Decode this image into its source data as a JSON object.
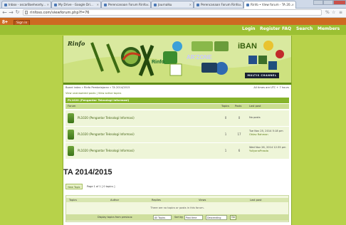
{
  "browser": {
    "tabs": [
      {
        "label": "Inbox - oscarBoehearty..."
      },
      {
        "label": "My Drive - Google Dri..."
      },
      {
        "label": "Perencanaan Forum Rinfo..."
      },
      {
        "label": "Journalku"
      },
      {
        "label": "Perencanaan Forum Rinfo..."
      },
      {
        "label": "Rinfo • View forum - TA 20..."
      }
    ],
    "url": "rinfoso.com/viewforum.php?f=76"
  },
  "google_bar": {
    "gplus": "8+",
    "signin": "Sign in"
  },
  "site_menu": [
    "Login",
    "Register",
    "FAQ",
    "Search",
    "Members"
  ],
  "banner": {
    "logo": "Rinfo",
    "rinfo": "Rinfo",
    "ar": "AR'ZONE",
    "iban": "iBAN",
    "mul": "MULTIS CHANNEL"
  },
  "breadcrumb": "Board index » Rinfo Pembelajaran » TA 2014/2015",
  "server_time": "All times are UTC + 7 hours",
  "view_links": "View unanswered posts | View active topics",
  "category_title": "PL1020 (Pengantar Teknologi Informasi)",
  "table_headers": {
    "forum": "Forum",
    "topics": "Topics",
    "posts": "Posts",
    "last": "Last post"
  },
  "forums": [
    {
      "name": "PL1020 (Pengantar Teknologi Informasi)",
      "topics": "0",
      "posts": "0",
      "last1": "No posts",
      "last2": ""
    },
    {
      "name": "PL1020 (Pengantar Teknologi Informasi)",
      "topics": "1",
      "posts": "17",
      "last1": "Tue Nov 25, 2014 5:18 pm",
      "last2": "Oktav Rahman"
    },
    {
      "name": "PL1020 (Pengantar Teknologi Informasi)",
      "topics": "1",
      "posts": "6",
      "last1": "Wed Nov 26, 2014 12:35 pm",
      "last2": "YuliyanaPrasda"
    }
  ],
  "section_title": "TA 2014/2015",
  "new_topic_label": "New Topic",
  "page_count": "Page 1 of 1 [ 0 topics ]",
  "topic_headers": {
    "topics": "Topics",
    "author": "Author",
    "replies": "Replies",
    "views": "Views",
    "last": "Last post"
  },
  "no_topics_msg": "There are no topics or posts in this forum.",
  "filter": {
    "display_label": "Display topics from previous:",
    "display_value": "All Topics",
    "sort_label": "Sort by",
    "sort_value": "Post time",
    "order_value": "Descending",
    "go": "Go"
  }
}
